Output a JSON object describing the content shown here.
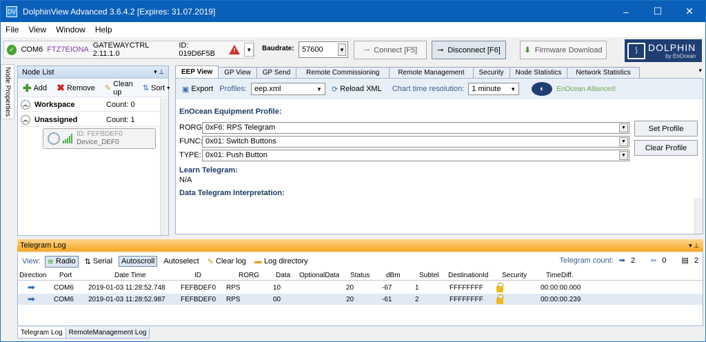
{
  "window": {
    "title": "DolphinView Advanced 3.6.4.2  [Expires: 31.07.2019]",
    "minimize": "–",
    "maximize": "☐",
    "close": "✕"
  },
  "menu": [
    "File",
    "View",
    "Window",
    "Help"
  ],
  "connection": {
    "port": "COM6",
    "device": "FTZ7EIONA",
    "gateway": "GATEWAYCTRL 2.11.1.0",
    "id": "ID: 019D6F5B"
  },
  "baudrate": {
    "label": "Baudrate:",
    "value": "57600"
  },
  "buttons": {
    "connect": "Connect [F5]",
    "disconnect": "Disconnect [F6]",
    "firmware": "Firmware Download"
  },
  "brand": {
    "name": "DOLPHIN",
    "sub": "by EnOcean"
  },
  "side_tab": "Node Properties",
  "node_list": {
    "title": "Node List",
    "add": "Add",
    "remove": "Remove",
    "clean_up": "Clean up",
    "sort": "Sort",
    "groups": [
      {
        "name": "Workspace",
        "count": "Count: 0"
      },
      {
        "name": "Unassigned",
        "count": "Count: 1"
      }
    ],
    "device": {
      "id": "ID: FEFBDEF0",
      "name": "Device_DEF0"
    }
  },
  "tabs": [
    "EEP View",
    "GP View",
    "GP Send",
    "Remote Commissioning",
    "Remote Management",
    "Security",
    "Node Statistics",
    "Network Statistics"
  ],
  "eep_toolbar": {
    "export": "Export",
    "profiles_label": "Profiles:",
    "profiles_value": "eep.xml",
    "reload": "Reload XML",
    "chart_label": "Chart time resolution:",
    "chart_value": "1 minute",
    "alliance": "EnOcean Alliance®"
  },
  "eep": {
    "heading": "EnOcean Equipment Profile:",
    "rorg_label": "RORG:",
    "rorg_value": "0xF6: RPS Telegram",
    "func_label": "FUNC:",
    "func_value": "0x01: Switch Buttons",
    "type_label": "TYPE:",
    "type_value": "0x01: Push Button",
    "set_profile": "Set Profile",
    "clear_profile": "Clear Profile",
    "learn_heading": "Learn Telegram:",
    "learn_value": "N/A",
    "data_heading": "Data Telegram Interpretation:"
  },
  "log": {
    "title": "Telegram Log",
    "view_label": "View:",
    "radio": "Radio",
    "serial": "Serial",
    "autoscroll": "Autoscroll",
    "autoselect": "Autoselect",
    "clear": "Clear log",
    "directory": "Log directory",
    "count_label": "Telegram count:",
    "count_in": "2",
    "count_out": "0",
    "count_total": "2",
    "columns": [
      "Direction",
      "Port",
      "Date Time",
      "ID",
      "RORG",
      "Data",
      "OptionalData",
      "Status",
      "dBm",
      "Subtel",
      "DestinationId",
      "Security",
      "TimeDiff."
    ],
    "rows": [
      {
        "port": "COM6",
        "datetime": "2019-01-03 11:28:52.748",
        "id": "FEFBDEF0",
        "rorg": "RPS",
        "data": "10",
        "optional": "",
        "status": "20",
        "dbm": "-67",
        "subtel": "1",
        "dest": "FFFFFFFF",
        "timediff": "00:00:00.000"
      },
      {
        "port": "COM6",
        "datetime": "2019-01-03 11:28:52.987",
        "id": "FEFBDEF0",
        "rorg": "RPS",
        "data": "00",
        "optional": "",
        "status": "20",
        "dbm": "-61",
        "subtel": "2",
        "dest": "FFFFFFFF",
        "timediff": "00:00:00.239"
      }
    ]
  },
  "bottom_tabs": [
    "Telegram Log",
    "RemoteManagement Log"
  ]
}
